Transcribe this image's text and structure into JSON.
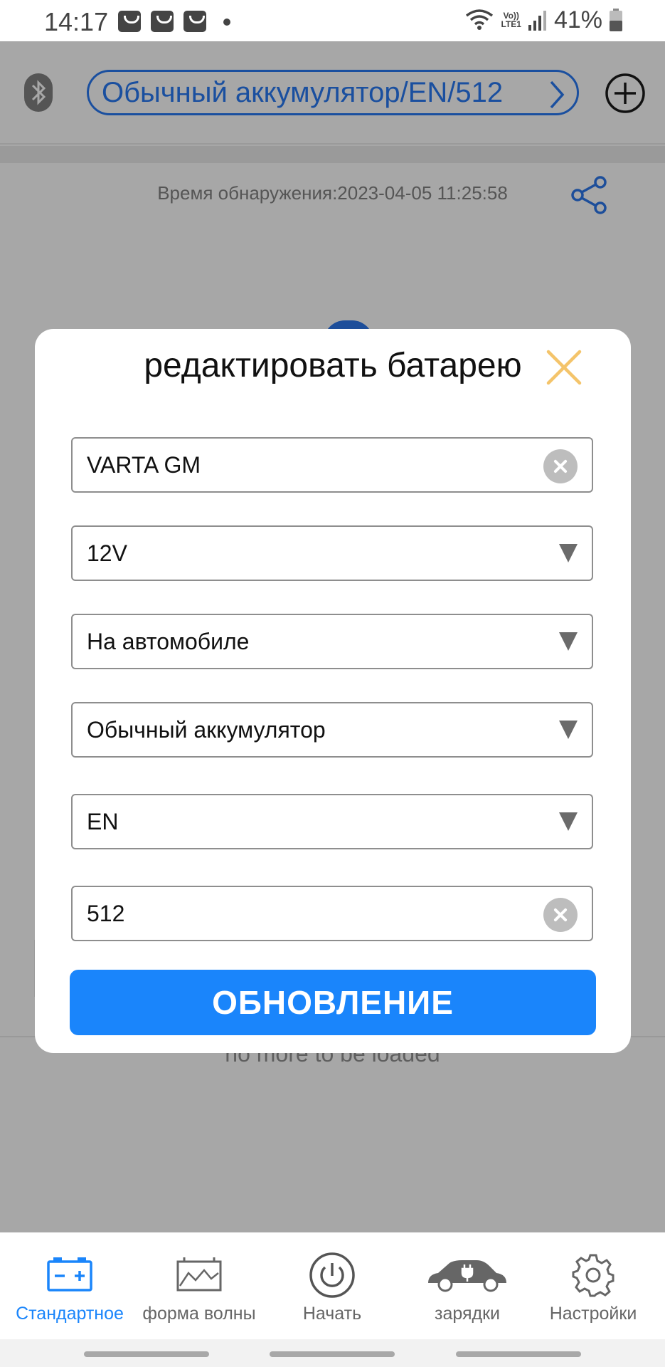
{
  "status_bar": {
    "time": "14:17",
    "lte_top": "Vo))",
    "lte_bottom": "LTE1",
    "battery_percent": "41%",
    "icons": [
      "notification-bag-icon",
      "notification-bag-icon",
      "notification-bag-icon",
      "wifi-icon",
      "signal-icon",
      "battery-icon"
    ]
  },
  "header": {
    "battery_profile": "Обычный аккумулятор/EN/512",
    "icons": [
      "bluetooth-icon",
      "chevron-right-icon",
      "add-circle-icon"
    ]
  },
  "main": {
    "detection_time": "Время обнаружения:2023-04-05 11:25:58",
    "no_more": "no more to be loaded"
  },
  "modal": {
    "title": "редактировать батарею",
    "fields": {
      "name": "VARTA GM",
      "voltage": "12V",
      "location": "На автомобиле",
      "type": "Обычный аккумулятор",
      "standard": "EN",
      "capacity": "512"
    },
    "update_button": "ОБНОВЛЕНИЕ"
  },
  "nav": {
    "items": [
      {
        "label": "Стандартное",
        "icon": "battery-icon",
        "active": true
      },
      {
        "label": "форма волны",
        "icon": "waveform-icon",
        "active": false
      },
      {
        "label": "Начать",
        "icon": "power-icon",
        "active": false
      },
      {
        "label": "зарядки",
        "icon": "car-charging-icon",
        "active": false
      },
      {
        "label": "Настройки",
        "icon": "gear-icon",
        "active": false
      }
    ]
  },
  "colors": {
    "accent": "#1a85fb",
    "header_blue": "#1a4f9f",
    "overlay": "#a7a7a7",
    "close_icon": "#f4c46a"
  }
}
